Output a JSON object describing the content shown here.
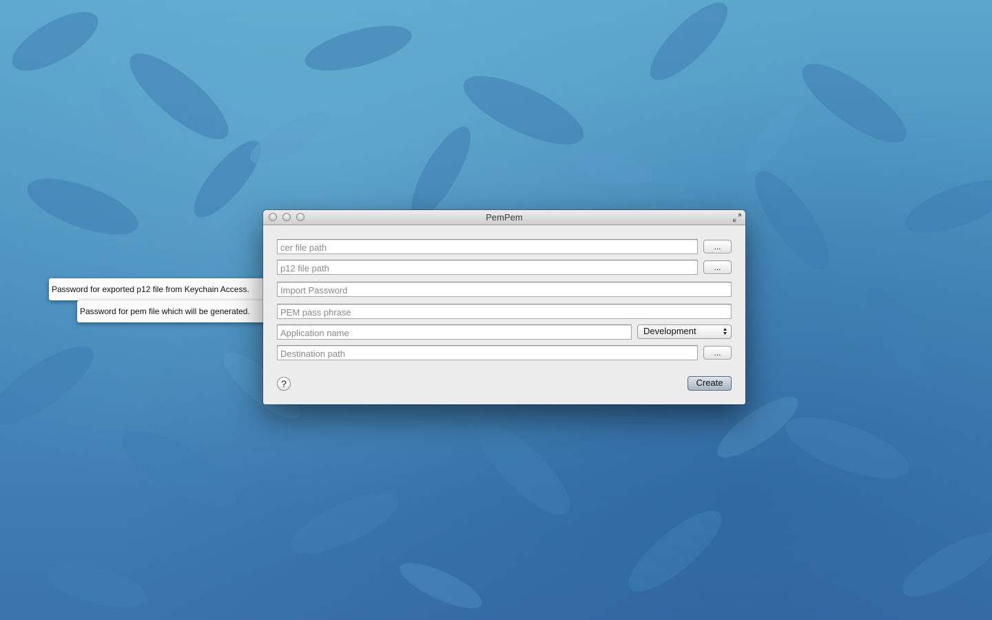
{
  "window": {
    "title": "PemPem"
  },
  "fields": {
    "cer_path": {
      "value": "",
      "placeholder": "cer file path"
    },
    "p12_path": {
      "value": "",
      "placeholder": "p12 file path"
    },
    "import_password": {
      "value": "",
      "placeholder": "Import Password"
    },
    "pem_pass_phrase": {
      "value": "",
      "placeholder": "PEM pass phrase"
    },
    "application_name": {
      "value": "",
      "placeholder": "Application name"
    },
    "destination_path": {
      "value": "",
      "placeholder": "Destination path"
    }
  },
  "buttons": {
    "browse_label": "...",
    "help_label": "?",
    "create_label": "Create"
  },
  "environment_popup": {
    "selected": "Development"
  },
  "tooltips": {
    "import_password": "Password for exported p12 file from Keychain Access.",
    "pem_pass_phrase": "Password for pem file which will be generated."
  },
  "icons": {
    "close": "traffic-light-close",
    "minimize": "traffic-light-minimize",
    "zoom": "traffic-light-zoom",
    "fullscreen": "fullscreen-arrows",
    "popup_arrows": "up-down-arrows"
  },
  "colors": {
    "wallpaper": "#4a90bf",
    "window_bg": "#ececec",
    "default_button": "#aab6c4"
  }
}
